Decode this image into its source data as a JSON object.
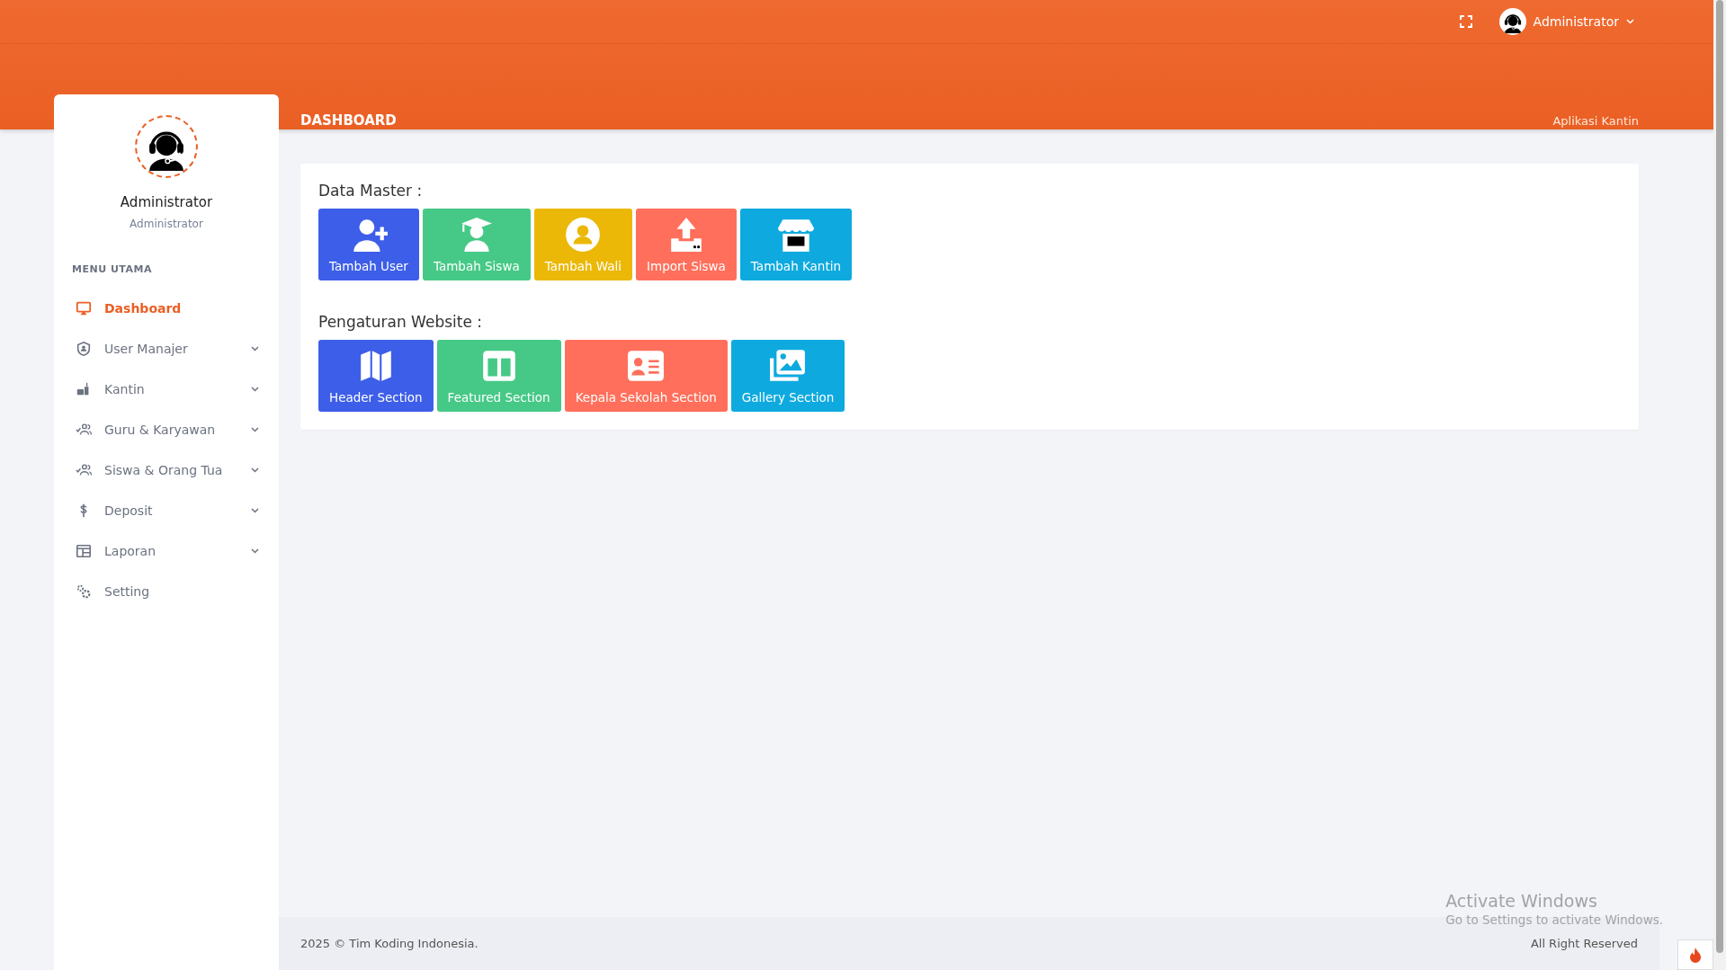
{
  "topbar": {
    "user_name": "Administrator"
  },
  "sidebar": {
    "profile_name": "Administrator",
    "profile_role": "Administrator",
    "section_label": "MENU UTAMA",
    "items": [
      {
        "label": "Dashboard",
        "selected": true,
        "kind": "link"
      },
      {
        "label": "User Manajer",
        "selected": false,
        "kind": "submenu"
      },
      {
        "label": "Kantin",
        "selected": false,
        "kind": "submenu"
      },
      {
        "label": "Guru & Karyawan",
        "selected": false,
        "kind": "submenu"
      },
      {
        "label": "Siswa & Orang Tua",
        "selected": false,
        "kind": "submenu"
      },
      {
        "label": "Deposit",
        "selected": false,
        "kind": "submenu"
      },
      {
        "label": "Laporan",
        "selected": false,
        "kind": "submenu"
      },
      {
        "label": "Setting",
        "selected": false,
        "kind": "link"
      }
    ]
  },
  "page": {
    "title": "DASHBOARD",
    "app_name": "Aplikasi Kantin"
  },
  "groups": [
    {
      "title": "Data Master :",
      "buttons": [
        {
          "label": "Tambah User",
          "color": "#3d5ee8"
        },
        {
          "label": "Tambah Siswa",
          "color": "#46c986"
        },
        {
          "label": "Tambah Wali",
          "color": "#ebb807"
        },
        {
          "label": "Import Siswa",
          "color": "#ff6f5b"
        },
        {
          "label": "Tambah Kantin",
          "color": "#0eaadf"
        }
      ]
    },
    {
      "title": "Pengaturan Website :",
      "buttons": [
        {
          "label": "Header Section",
          "color": "#3d5ee8"
        },
        {
          "label": "Featured Section",
          "color": "#46c986"
        },
        {
          "label": "Kepala Sekolah Section",
          "color": "#ff6f5b"
        },
        {
          "label": "Gallery Section",
          "color": "#0eaadf"
        }
      ]
    }
  ],
  "footer": {
    "copyright": "2025 © Tim Koding Indonesia.",
    "rights": "All Right Reserved"
  },
  "os_notice": {
    "title": "Activate Windows",
    "subtitle": "Go to Settings to activate Windows."
  }
}
